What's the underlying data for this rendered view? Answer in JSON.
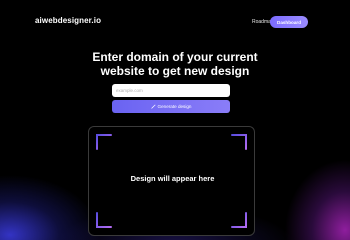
{
  "header": {
    "logo": "aiwebdesigner.io",
    "nav_link": "Roadmap",
    "dashboard_label": "Dashboard"
  },
  "hero": {
    "headline_line1": "Enter domain of your current",
    "headline_line2": "website to get new design"
  },
  "form": {
    "input_value": "",
    "input_placeholder": "example.com",
    "generate_label": "Generate design",
    "generate_icon": "magic-wand-icon"
  },
  "preview": {
    "placeholder_text": "Design will appear here",
    "corner_icon": "corner-bracket-icon"
  },
  "colors": {
    "background": "#000000",
    "accent": "#7b6bff",
    "corner_gradient_start": "#5a4de0",
    "corner_gradient_end": "#b36cf2",
    "glow_blue": "#3c3ce6",
    "glow_magenta": "#be28d2"
  }
}
